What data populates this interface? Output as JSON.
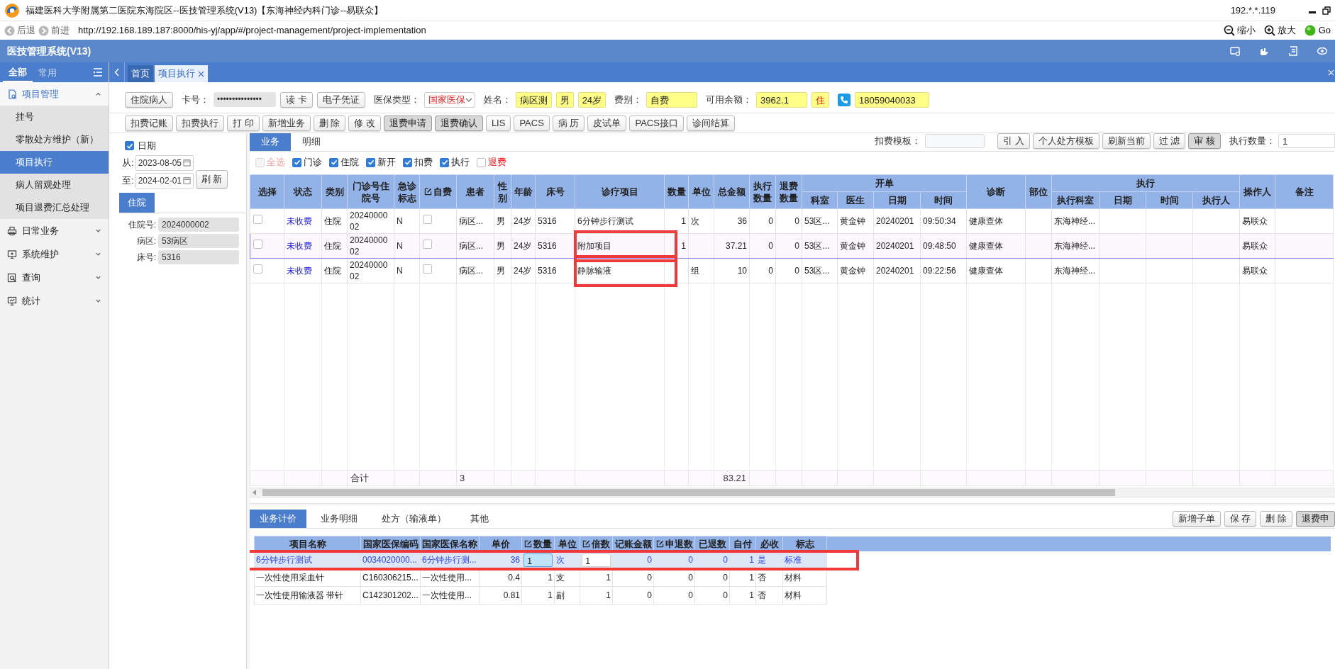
{
  "window": {
    "title": "福建医科大学附属第二医院东海院区--医技管理系统(V13)【东海神经内科门诊--易联众】",
    "host": "192.*.*.119"
  },
  "browser": {
    "back": "后退",
    "forward": "前进",
    "url": "http://192.168.189.187:8000/his-yj/app/#/project-management/project-implementation",
    "zoom_out": "缩小",
    "zoom_in": "放大",
    "go": "Go"
  },
  "app": {
    "title": "医技管理系统(V13)"
  },
  "sidebar": {
    "tabs": [
      {
        "label": "全部",
        "selected": true
      },
      {
        "label": "常用",
        "selected": false
      }
    ],
    "items": [
      {
        "label": "项目管理",
        "expanded": true,
        "children": [
          {
            "label": "挂号",
            "selected": false
          },
          {
            "label": "零散处方维护（新）",
            "selected": false
          },
          {
            "label": "项目执行",
            "selected": true
          },
          {
            "label": "病人留观处理",
            "selected": false
          },
          {
            "label": "项目退费汇总处理",
            "selected": false
          }
        ]
      },
      {
        "label": "日常业务",
        "expanded": false
      },
      {
        "label": "系统维护",
        "expanded": false
      },
      {
        "label": "查询",
        "expanded": false
      },
      {
        "label": "统计",
        "expanded": false
      }
    ]
  },
  "page_tabs": [
    {
      "label": "首页",
      "selected": false,
      "closable": false
    },
    {
      "label": "项目执行",
      "selected": true,
      "closable": true
    }
  ],
  "patient_bar": [
    {
      "kind": "button",
      "label": "住院病人"
    },
    {
      "kind": "label",
      "text": "卡号："
    },
    {
      "kind": "masked",
      "value": "•••••••••••••••"
    },
    {
      "kind": "button",
      "label": "读 卡"
    },
    {
      "kind": "button",
      "label": "电子凭证"
    },
    {
      "kind": "label",
      "text": "医保类型："
    },
    {
      "kind": "select",
      "value": "国家医保"
    },
    {
      "kind": "label",
      "text": "姓名："
    },
    {
      "kind": "value",
      "value": "病区测",
      "wide": false,
      "alert": false
    },
    {
      "kind": "value",
      "value": "男",
      "wide": false,
      "alert": false
    },
    {
      "kind": "value",
      "value": "24岁",
      "wide": false,
      "alert": false
    },
    {
      "kind": "label",
      "text": "费别："
    },
    {
      "kind": "value",
      "value": "自费",
      "wide": true,
      "alert": false
    },
    {
      "kind": "label",
      "text": "可用余额："
    },
    {
      "kind": "value",
      "value": "3962.1",
      "wide": true,
      "alert": false
    },
    {
      "kind": "value",
      "value": "住",
      "wide": false,
      "alert": true
    },
    {
      "kind": "phone"
    },
    {
      "kind": "value",
      "value": "18059040033",
      "wide": true,
      "alert": false
    }
  ],
  "actions": [
    {
      "label": "扣费记账",
      "pressed": false
    },
    {
      "label": "扣费执行",
      "pressed": false
    },
    {
      "label": "打 印",
      "pressed": false
    },
    {
      "label": "新增业务",
      "pressed": false
    },
    {
      "label": "删 除",
      "pressed": false
    },
    {
      "label": "修 改",
      "pressed": false
    },
    {
      "label": "退费申请",
      "pressed": true
    },
    {
      "label": "退费确认",
      "pressed": true
    },
    {
      "label": "LIS",
      "pressed": false
    },
    {
      "label": "PACS",
      "pressed": false
    },
    {
      "label": "病 历",
      "pressed": false
    },
    {
      "label": "皮试单",
      "pressed": false
    },
    {
      "label": "PACS接口",
      "pressed": false
    },
    {
      "label": "诊间结算",
      "pressed": false
    }
  ],
  "filter": {
    "date_enabled": true,
    "date_label": "日期",
    "from_label": "从:",
    "from": "2023-08-05",
    "to_label": "至:",
    "to": "2024-02-01",
    "refresh": "刷 新"
  },
  "side_tabs": [
    {
      "label": "住院",
      "selected": true
    }
  ],
  "patient_info": [
    {
      "label": "住院号:",
      "value": "2024000002"
    },
    {
      "label": "病区:",
      "value": "53病区"
    },
    {
      "label": "床号:",
      "value": "5316"
    }
  ],
  "main": {
    "tabs": [
      {
        "label": "业务",
        "selected": true
      },
      {
        "label": "明细",
        "selected": false
      }
    ],
    "template_label": "扣费模板：",
    "buttons": [
      {
        "label": "引 入",
        "pressed": false
      },
      {
        "label": "个人处方模板",
        "pressed": false
      },
      {
        "label": "刷新当前",
        "pressed": false
      },
      {
        "label": "过 滤",
        "pressed": false
      },
      {
        "label": "审 核",
        "pressed": true
      }
    ],
    "count_label": "执行数量：",
    "count": "1",
    "checks": [
      {
        "label": "全选",
        "checked": false,
        "disabled": true,
        "warn": true
      },
      {
        "label": "门诊",
        "checked": true,
        "disabled": false,
        "warn": false
      },
      {
        "label": "住院",
        "checked": true,
        "disabled": false,
        "warn": false
      },
      {
        "label": "新开",
        "checked": true,
        "disabled": false,
        "warn": false
      },
      {
        "label": "扣费",
        "checked": true,
        "disabled": false,
        "warn": false
      },
      {
        "label": "执行",
        "checked": true,
        "disabled": false,
        "warn": false
      },
      {
        "label": "退费",
        "checked": false,
        "disabled": false,
        "warn": true
      }
    ],
    "table": {
      "columns": [
        {
          "label": "选择"
        },
        {
          "label": "状态",
          "kind": "status"
        },
        {
          "label": "类别"
        },
        {
          "label": "门诊号住院号"
        },
        {
          "label": "急诊标志"
        },
        {
          "label": "自费",
          "editable": true
        },
        {
          "label": "患者"
        },
        {
          "label": "性别"
        },
        {
          "label": "年龄"
        },
        {
          "label": "床号"
        },
        {
          "label": "诊疗项目",
          "kind": "item"
        },
        {
          "label": "数量"
        },
        {
          "label": "单位"
        },
        {
          "label": "总金额"
        },
        {
          "label": "执行数量"
        },
        {
          "label": "退费数量"
        },
        {
          "label": "开单",
          "colspan": 4,
          "children": [
            {
              "label": "科室"
            },
            {
              "label": "医生"
            },
            {
              "label": "日期"
            },
            {
              "label": "时间"
            }
          ]
        },
        {
          "label": "诊断"
        },
        {
          "label": "部位"
        },
        {
          "label": "执行",
          "colspan": 4,
          "children": [
            {
              "label": "执行科室"
            },
            {
              "label": "日期"
            },
            {
              "label": "时间"
            },
            {
              "label": "执行人"
            }
          ]
        },
        {
          "label": "操作人"
        },
        {
          "label": "备注"
        }
      ],
      "rows": [
        {
          "selected": false,
          "marked": false,
          "cells": [
            {
              "checked": false
            },
            "未收费",
            "住院",
            "2024000002",
            "N",
            {
              "checked": false
            },
            "病区...",
            "男",
            "24岁",
            "5316",
            "6分钟步行测试",
            "1",
            "次",
            "36",
            "0",
            "0",
            "53区...",
            "黄金钟",
            "20240201",
            "09:50:34",
            "健康查体",
            null,
            "东海神经...",
            null,
            null,
            null,
            "易联众",
            null
          ]
        },
        {
          "selected": true,
          "marked": true,
          "cells": [
            {
              "checked": false
            },
            "未收费",
            "住院",
            "2024000002",
            "N",
            {
              "checked": false
            },
            "病区...",
            "男",
            "24岁",
            "5316",
            "附加项目",
            "1",
            null,
            "37.21",
            "0",
            "0",
            "53区...",
            "黄金钟",
            "20240201",
            "09:48:50",
            "健康查体",
            null,
            "东海神经...",
            null,
            null,
            null,
            "易联众",
            null
          ]
        },
        {
          "selected": false,
          "marked": true,
          "cells": [
            {
              "checked": false
            },
            "未收费",
            "住院",
            "2024000002",
            "N",
            {
              "checked": false
            },
            "病区...",
            "男",
            "24岁",
            "5316",
            "静脉输液",
            null,
            "组",
            "10",
            "0",
            "0",
            "53区...",
            "黄金钟",
            "20240201",
            "09:22:56",
            "健康查体",
            null,
            "东海神经...",
            null,
            null,
            null,
            "易联众",
            null
          ]
        }
      ],
      "totals": {
        "label": "合计",
        "count": "3",
        "amount": "83.21"
      }
    }
  },
  "detail": {
    "tabs": [
      {
        "label": "业务计价",
        "selected": true
      },
      {
        "label": "业务明细",
        "selected": false
      },
      {
        "label": "处方（输液单）",
        "selected": false
      },
      {
        "label": "其他",
        "selected": false
      }
    ],
    "buttons": [
      {
        "label": "新增子单",
        "pressed": false
      },
      {
        "label": "保 存",
        "pressed": false
      },
      {
        "label": "删 除",
        "pressed": false
      },
      {
        "label": "退费申",
        "pressed": true
      }
    ],
    "table": {
      "columns": [
        {
          "label": "项目名称"
        },
        {
          "label": "国家医保编码"
        },
        {
          "label": "国家医保名称"
        },
        {
          "label": "单价"
        },
        {
          "label": "数量",
          "editable": true
        },
        {
          "label": "单位"
        },
        {
          "label": "倍数",
          "editable": true
        },
        {
          "label": "记账金额"
        },
        {
          "label": "申退数",
          "editable": true
        },
        {
          "label": "已退数"
        },
        {
          "label": "自付"
        },
        {
          "label": "必收"
        },
        {
          "label": "标志"
        }
      ],
      "rows": [
        {
          "selected": true,
          "marked": true,
          "cells": [
            "6分钟步行测试",
            "0034020000...",
            "6分钟步行测...",
            "36",
            {
              "kind": "input",
              "value": "1",
              "focused": true
            },
            "次",
            {
              "kind": "input",
              "value": "1",
              "focused": false
            },
            "0",
            "0",
            "0",
            "1",
            "是",
            "标准"
          ]
        },
        {
          "selected": false,
          "marked": false,
          "cells": [
            "一次性使用采血针",
            "C160306215...",
            "一次性使用...",
            "0.4",
            "1",
            "支",
            "1",
            "0",
            "0",
            "0",
            "1",
            "否",
            "材料"
          ]
        },
        {
          "selected": false,
          "marked": false,
          "cells": [
            "一次性使用输液器 带针",
            "C142301202...",
            "一次性使用...",
            "0.81",
            "1",
            "副",
            "1",
            "0",
            "0",
            "0",
            "1",
            "否",
            "材料"
          ]
        }
      ]
    }
  }
}
